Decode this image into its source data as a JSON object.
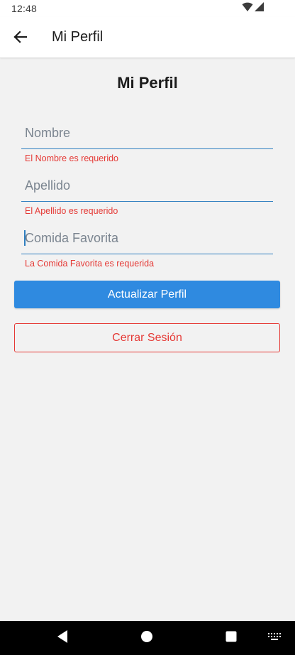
{
  "status_bar": {
    "time": "12:48",
    "icons": [
      "wifi-icon",
      "cell-signal-icon"
    ]
  },
  "app_bar": {
    "back_icon": "arrow-left-icon",
    "title": "Mi Perfil"
  },
  "main": {
    "heading": "Mi Perfil",
    "fields": [
      {
        "placeholder": "Nombre",
        "value": "",
        "error": "El Nombre es requerido"
      },
      {
        "placeholder": "Apellido",
        "value": "",
        "error": "El Apellido es requerido"
      },
      {
        "placeholder": "Comida Favorita",
        "value": "",
        "error": "La Comida Favorita es requerida"
      }
    ],
    "update_button_label": "Actualizar Perfil",
    "logout_button_label": "Cerrar Sesión"
  },
  "nav_bar": {
    "icons": [
      "back-triangle-icon",
      "home-circle-icon",
      "recents-square-icon",
      "keyboard-icon"
    ]
  },
  "colors": {
    "accent": "#2f8ae0",
    "field_line": "#2f7fc0",
    "error": "#e53935",
    "background": "#f2f2f2"
  }
}
